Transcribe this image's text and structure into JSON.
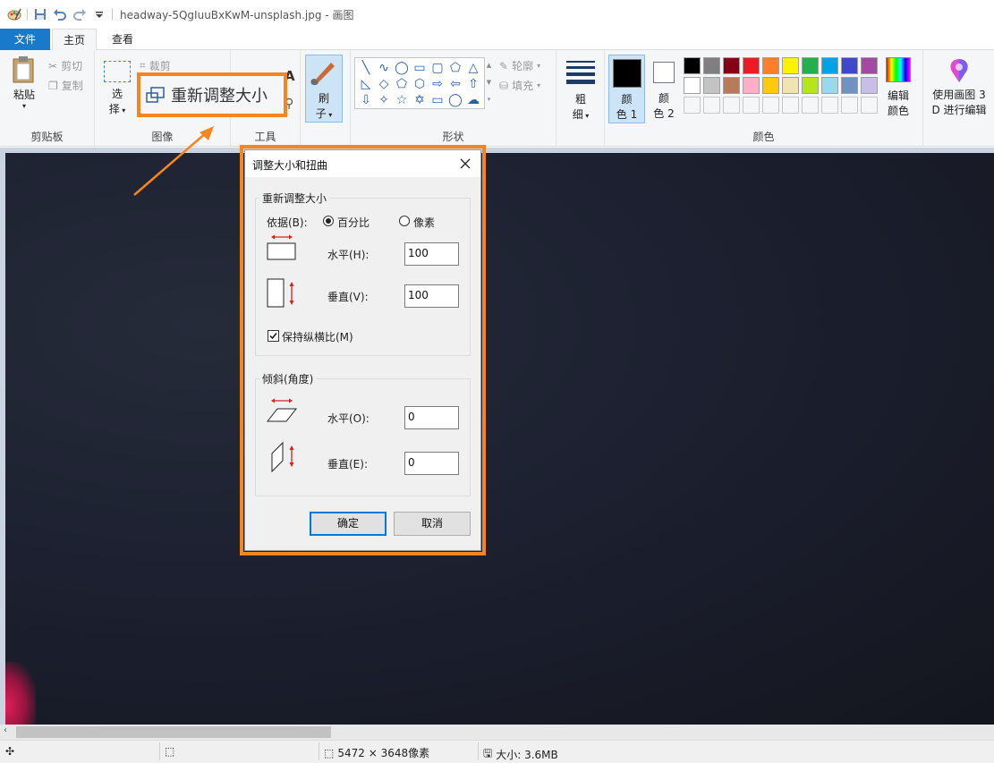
{
  "window": {
    "title": "headway-5QgIuuBxKwM-unsplash.jpg - 画图"
  },
  "tabs": {
    "file": "文件",
    "home": "主页",
    "view": "查看"
  },
  "ribbon": {
    "clipboard": {
      "paste": "粘贴",
      "cut": "剪切",
      "copy": "复制",
      "label": "剪贴板"
    },
    "image": {
      "select_line1": "选",
      "select_line2": "择",
      "crop": "裁剪",
      "label": "图像"
    },
    "tools": {
      "label": "工具"
    },
    "brush": {
      "line1": "刷",
      "line2": "子"
    },
    "shapes": {
      "outline": "轮廓",
      "fill": "填充",
      "label": "形状"
    },
    "size": {
      "line1": "粗",
      "line2": "细"
    },
    "colors": {
      "color1_line1": "颜",
      "color1_line2": "色 1",
      "color2_line1": "颜",
      "color2_line2": "色 2",
      "edit_line1": "编辑",
      "edit_line2": "颜色",
      "label": "颜色",
      "palette_row1": [
        "#000000",
        "#7f7f7f",
        "#880015",
        "#ed1c24",
        "#ff7f27",
        "#fff200",
        "#22b14c",
        "#00a2e8",
        "#3f48cc",
        "#a349a4"
      ],
      "palette_row2": [
        "#ffffff",
        "#c3c3c3",
        "#b97a57",
        "#ffaec9",
        "#ffc90e",
        "#efe4b0",
        "#b5e61d",
        "#99d9ea",
        "#7092be",
        "#c8bfe7"
      ],
      "color1": "#000000",
      "color2": "#ffffff"
    },
    "paint3d": {
      "line1": "使用画图 3",
      "line2": "D 进行编辑"
    }
  },
  "callout": {
    "resize_label": "重新调整大小",
    "accent": "#f5851f"
  },
  "dialog": {
    "title": "调整大小和扭曲",
    "resize_group": "重新调整大小",
    "by_label": "依据(B):",
    "option_percent": "百分比",
    "option_pixels": "像素",
    "selected_unit": "百分比",
    "horizontal_label": "水平(H):",
    "horizontal_value": "100",
    "vertical_label": "垂直(V):",
    "vertical_value": "100",
    "keep_ratio_label": "保持纵横比(M)",
    "keep_ratio": true,
    "skew_group": "倾斜(角度)",
    "skew_h_label": "水平(O):",
    "skew_h_value": "0",
    "skew_v_label": "垂直(E):",
    "skew_v_value": "0",
    "ok": "确定",
    "cancel": "取消"
  },
  "status": {
    "dimensions": "5472 × 3648像素",
    "size": "大小: 3.6MB"
  }
}
